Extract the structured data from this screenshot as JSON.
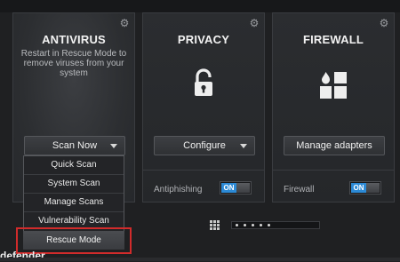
{
  "panels": [
    {
      "title": "ANTIVIRUS",
      "description": "Restart in Rescue Mode to remove viruses from your system",
      "button": "Scan Now",
      "menu": [
        "Quick Scan",
        "System Scan",
        "Manage Scans",
        "Vulnerability Scan",
        "Rescue Mode"
      ]
    },
    {
      "title": "PRIVACY",
      "icon": "padlock-open-icon",
      "button": "Configure",
      "toggle_label": "Antiphishing",
      "toggle_state": "ON"
    },
    {
      "title": "FIREWALL",
      "icon": "firewall-blocks-icon",
      "button": "Manage adapters",
      "toggle_label": "Firewall",
      "toggle_state": "ON"
    }
  ],
  "footer": {
    "brand": "defender",
    "pager_dots": 5
  },
  "colors": {
    "accent_on": "#2c8ad6",
    "highlight": "#d12b2b"
  }
}
